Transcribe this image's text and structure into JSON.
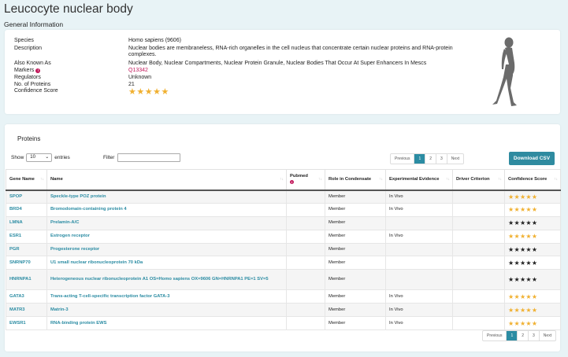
{
  "page": {
    "title": "Leucocyte nuclear body"
  },
  "general": {
    "section_title": "General Information",
    "rows": [
      {
        "label": "Species",
        "value": "Homo sapiens (9606)"
      },
      {
        "label": "Description",
        "value": "Nuclear bodies are membraneless, RNA-rich organelles in the cell nucleus that concentrate certain nuclear proteins and RNA-protein complexes."
      },
      {
        "label": "Also Known As",
        "value": "Nuclear Body, Nuclear Compartments, Nuclear Protein Granule, Nuclear Bodies That Occur At Super Enhancers In Mescs"
      },
      {
        "label": "Markers",
        "value": "Q13342",
        "info_icon": "info-icon"
      },
      {
        "label": "Regulators",
        "value": "Unknown"
      },
      {
        "label": "No. of Proteins",
        "value": "21"
      },
      {
        "label": "Confidence Score",
        "value": "★★★★★",
        "stars": 5
      }
    ],
    "figure_icon": "human-silhouette-icon"
  },
  "proteins": {
    "title": "Proteins",
    "show_label": "Show",
    "entries_value": "10",
    "entries_label": "entries",
    "filter_label": "Filter",
    "filter_value": "",
    "download_label": "Download CSV",
    "pager": {
      "previous": "Previous",
      "pages": [
        "1",
        "2",
        "3"
      ],
      "next": "Next",
      "active": "1"
    },
    "columns": [
      "Gene Name",
      "Name",
      "Pubmed",
      "Role in Condensate",
      "Experimental Evidence",
      "Driver Criterion",
      "Confidence Score"
    ],
    "rows": [
      {
        "gene": "SPOP",
        "name": "Speckle-type POZ protein",
        "role": "Member",
        "evidence": "In Vivo",
        "criterion": "",
        "score": "★★★★★",
        "star_color": "gold"
      },
      {
        "gene": "BRD4",
        "name": "Bromodomain-containing protein 4",
        "role": "Member",
        "evidence": "In Vivo",
        "criterion": "",
        "score": "★★★★★",
        "star_color": "gold"
      },
      {
        "gene": "LMNA",
        "name": "Prelamin-A/C",
        "role": "Member",
        "evidence": "",
        "criterion": "",
        "score": "★★★★★",
        "star_color": "black"
      },
      {
        "gene": "ESR1",
        "name": "Estrogen receptor",
        "role": "Member",
        "evidence": "In Vivo",
        "criterion": "",
        "score": "★★★★★",
        "star_color": "gold"
      },
      {
        "gene": "PGR",
        "name": "Progesterone receptor",
        "role": "Member",
        "evidence": "",
        "criterion": "",
        "score": "★★★★★",
        "star_color": "black"
      },
      {
        "gene": "SNRNP70",
        "name": "U1 small nuclear ribonucleoprotein 70 kDa",
        "role": "Member",
        "evidence": "",
        "criterion": "",
        "score": "★★★★★",
        "star_color": "black"
      },
      {
        "gene": "HNRNPA1",
        "name": "Heterogeneous nuclear ribonucleoprotein A1 OS=Homo sapiens OX=9606 GN=HNRNPA1 PE=1 SV=5",
        "role": "Member",
        "evidence": "",
        "criterion": "",
        "score": "★★★★★",
        "star_color": "black"
      },
      {
        "gene": "GATA3",
        "name": "Trans-acting T-cell-specific transcription factor GATA-3",
        "role": "Member",
        "evidence": "In Vivo",
        "criterion": "",
        "score": "★★★★★",
        "star_color": "gold"
      },
      {
        "gene": "MATR3",
        "name": "Matrin-3",
        "role": "Member",
        "evidence": "In Vivo",
        "criterion": "",
        "score": "★★★★★",
        "star_color": "gold"
      },
      {
        "gene": "EWSR1",
        "name": "RNA-binding protein EWS",
        "role": "Member",
        "evidence": "In Vivo",
        "criterion": "",
        "score": "★★★★★",
        "star_color": "gold"
      }
    ]
  },
  "colors": {
    "accent": "#2b8ca3",
    "marker_link": "#c2185b",
    "star_gold": "#f0b030",
    "star_black": "#222222",
    "background": "#e8f3f6"
  }
}
